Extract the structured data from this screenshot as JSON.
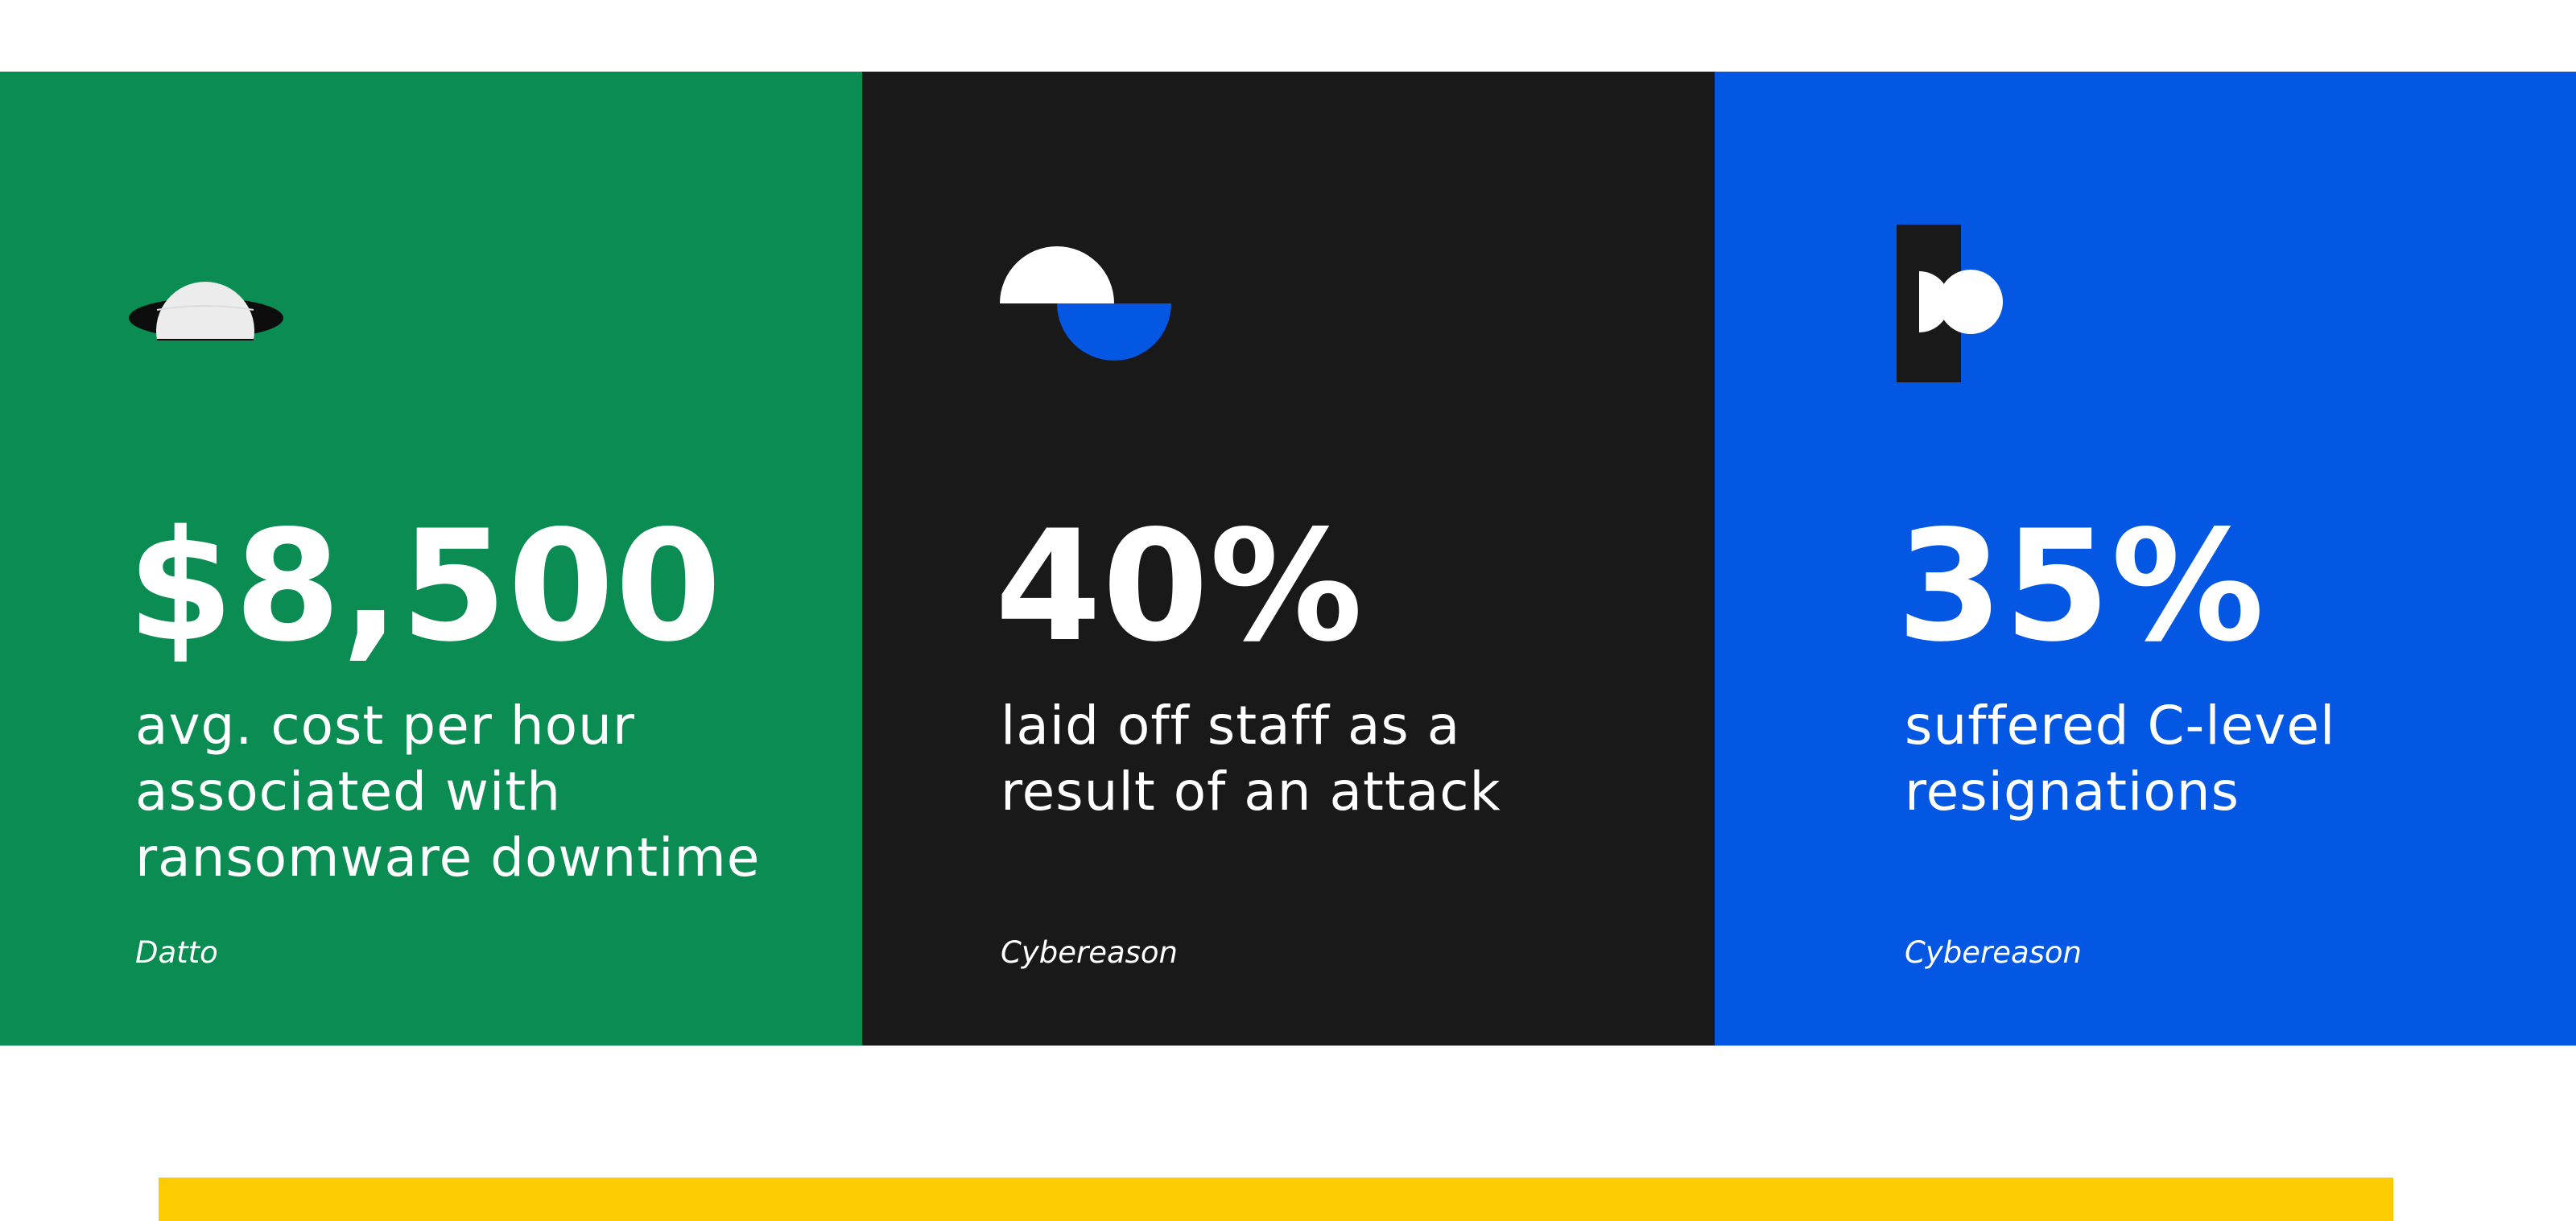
{
  "colors": {
    "background": "#ffffff",
    "green": "#0a8c52",
    "black": "#191919",
    "blue": "#0357e2",
    "yellow": "#fccb02",
    "white": "#ffffff",
    "light_gray": "#ececec"
  },
  "cards": [
    {
      "icon": "ball-in-hole-icon",
      "stat": "$8,500",
      "description": "avg. cost per hour\nassociated with\nransomware downtime",
      "source": "Datto"
    },
    {
      "icon": "split-semicircles-icon",
      "stat": "40%",
      "description": "laid off staff as a\nresult of an attack",
      "source": "Cybereason"
    },
    {
      "icon": "bar-and-dots-icon",
      "stat": "35%",
      "description": "suffered C-level\nresignations",
      "source": "Cybereason"
    }
  ]
}
